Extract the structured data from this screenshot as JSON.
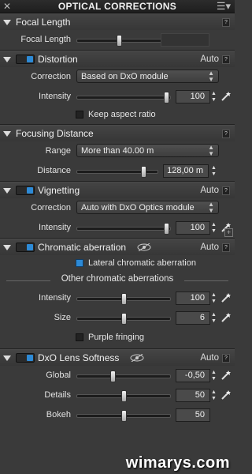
{
  "panel": {
    "title": "OPTICAL CORRECTIONS",
    "close": "✕",
    "menu": "☰▾"
  },
  "help_label": "?",
  "auto_label": "Auto",
  "focal_length": {
    "title": "Focal Length",
    "label": "Focal Length",
    "value": "",
    "slider": 0.45
  },
  "distortion": {
    "title": "Distortion",
    "auto": "Auto",
    "correction_label": "Correction",
    "correction_value": "Based on DxO module",
    "intensity_label": "Intensity",
    "intensity_value": "100",
    "intensity_slider": 0.96,
    "keep_aspect_label": "Keep aspect ratio",
    "keep_aspect_checked": false
  },
  "focusing": {
    "title": "Focusing Distance",
    "range_label": "Range",
    "range_value": "More than 40.00 m",
    "distance_label": "Distance",
    "distance_value": "128,00 m",
    "distance_slider": 0.82
  },
  "vignetting": {
    "title": "Vignetting",
    "auto": "Auto",
    "correction_label": "Correction",
    "correction_value": "Auto with DxO Optics module",
    "intensity_label": "Intensity",
    "intensity_value": "100",
    "intensity_slider": 0.96
  },
  "chromatic": {
    "title": "Chromatic aberration",
    "auto": "Auto",
    "lateral_label": "Lateral chromatic aberration",
    "lateral_checked": true,
    "other_heading": "Other chromatic aberrations",
    "intensity_label": "Intensity",
    "intensity_value": "100",
    "intensity_slider": 0.5,
    "size_label": "Size",
    "size_value": "6",
    "size_slider": 0.5,
    "purple_label": "Purple fringing",
    "purple_checked": false
  },
  "softness": {
    "title": "DxO Lens Softness",
    "auto": "Auto",
    "global_label": "Global",
    "global_value": "-0,50",
    "global_slider": 0.38,
    "details_label": "Details",
    "details_value": "50",
    "details_slider": 0.5,
    "bokeh_label": "Bokeh",
    "bokeh_value": "50",
    "bokeh_slider": 0.5
  },
  "watermark": "wimarys.com"
}
